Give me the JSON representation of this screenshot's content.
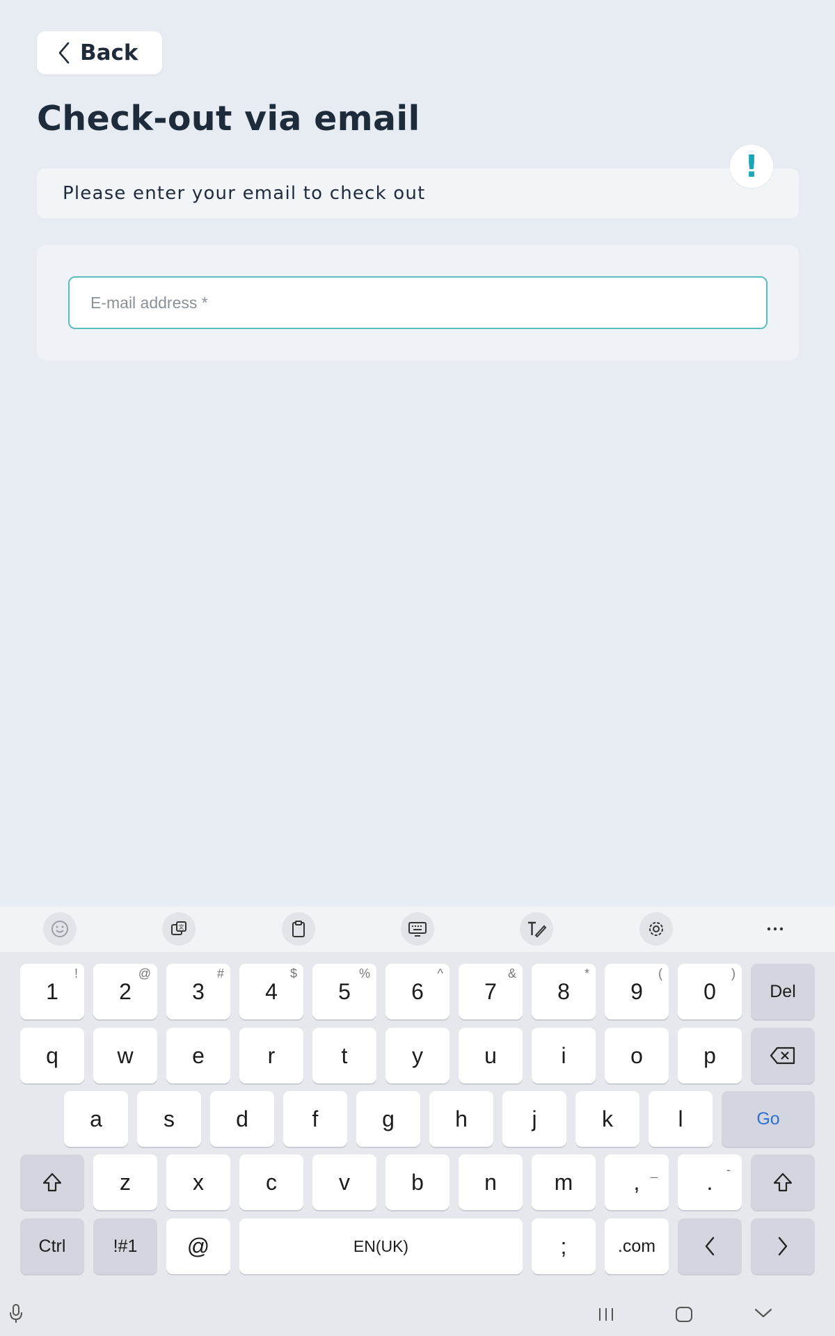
{
  "header": {
    "back_label": "Back",
    "title": "Check-out via email"
  },
  "info": {
    "message": "Please enter your email to check out",
    "badge": "!"
  },
  "form": {
    "email_placeholder": "E-mail address *",
    "email_value": ""
  },
  "colors": {
    "accent": "#1aa6b7",
    "background": "#e6ecf2",
    "input_border": "#5bbcbf"
  },
  "keyboard": {
    "toolbar_icons": [
      "emoji-icon",
      "translate-icon",
      "clipboard-icon",
      "keyboard-icon",
      "handwriting-icon",
      "settings-icon",
      "more-icon"
    ],
    "row1": [
      {
        "label": "1",
        "alt": "!"
      },
      {
        "label": "2",
        "alt": "@"
      },
      {
        "label": "3",
        "alt": "#"
      },
      {
        "label": "4",
        "alt": "$"
      },
      {
        "label": "5",
        "alt": "%"
      },
      {
        "label": "6",
        "alt": "^"
      },
      {
        "label": "7",
        "alt": "&"
      },
      {
        "label": "8",
        "alt": "*"
      },
      {
        "label": "9",
        "alt": "("
      },
      {
        "label": "0",
        "alt": ")"
      }
    ],
    "del_label": "Del",
    "row2": [
      "q",
      "w",
      "e",
      "r",
      "t",
      "y",
      "u",
      "i",
      "o",
      "p"
    ],
    "row3": [
      "a",
      "s",
      "d",
      "f",
      "g",
      "h",
      "j",
      "k",
      "l"
    ],
    "go_label": "Go",
    "row4": [
      "z",
      "x",
      "c",
      "v",
      "b",
      "n",
      "m"
    ],
    "comma": {
      "label": ",",
      "alt": "–"
    },
    "period": {
      "label": ".",
      "alt": "-"
    },
    "ctrl_label": "Ctrl",
    "symbols_label": "!#1",
    "at_label": "@",
    "space_label": "EN(UK)",
    "semicolon_label": ";",
    "dotcom_label": ".com"
  }
}
